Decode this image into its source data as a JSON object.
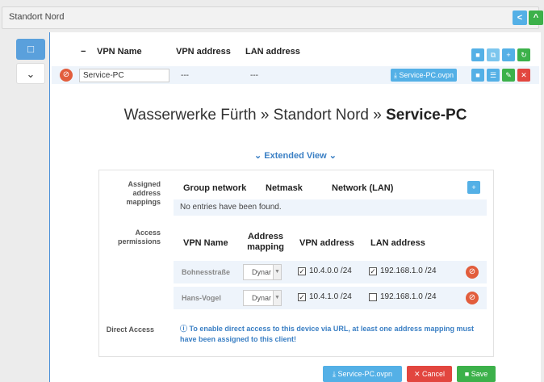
{
  "topbar": {
    "title": "Standort Nord",
    "share_icon": "share-icon",
    "collapse_icon": "chevron-up-icon"
  },
  "sidebar": {
    "items": [
      {
        "icon": "monitor-icon"
      },
      {
        "icon": "chevron-down-icon"
      }
    ]
  },
  "list": {
    "collapse_mark": "−",
    "headers": {
      "vpn_name": "VPN Name",
      "vpn_address": "VPN address",
      "lan_address": "LAN address"
    },
    "row": {
      "name": "Service-PC",
      "vpn_address": "---",
      "lan_address": "---",
      "ovpn_label": "Service-PC.ovpn"
    }
  },
  "heading": {
    "prefix": "Wasserwerke Fürth » Standort Nord » ",
    "client": "Service-PC"
  },
  "extended_view": "Extended View",
  "assigned": {
    "label": "Assigned address mappings",
    "headers": {
      "group": "Group network",
      "netmask": "Netmask",
      "network": "Network (LAN)"
    },
    "empty": "No entries have been found."
  },
  "access": {
    "label": "Access permissions",
    "headers": {
      "vpn_name": "VPN Name",
      "mapping": "Address mapping",
      "vpn_address": "VPN address",
      "lan_address": "LAN address"
    },
    "rows": [
      {
        "name": "Bohnesstraße",
        "mapping": "Dynar",
        "vpn_checked": true,
        "vpn": "10.4.0.0 /24",
        "lan_checked": true,
        "lan": "192.168.1.0 /24"
      },
      {
        "name": "Hans-Vogel",
        "mapping": "Dynar",
        "vpn_checked": true,
        "vpn": "10.4.1.0 /24",
        "lan_checked": false,
        "lan": "192.168.1.0 /24"
      }
    ]
  },
  "direct": {
    "label": "Direct Access",
    "info": "To enable direct access to this device via URL, at least one address mapping must have been assigned to this client!"
  },
  "buttons": {
    "ovpn": "Service-PC.ovpn",
    "cancel": "Cancel",
    "save": "Save"
  },
  "colors": {
    "accent": "#54b0e6",
    "green": "#3cb14a",
    "red": "#e2463f",
    "link": "#3a7fc4"
  }
}
